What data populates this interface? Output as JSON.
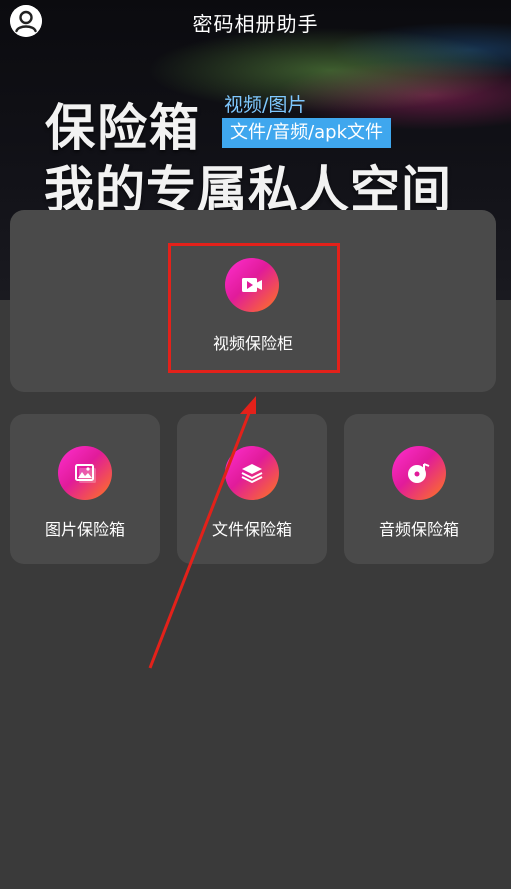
{
  "header": {
    "title": "密码相册助手"
  },
  "banner": {
    "headline": "保险箱",
    "sub_tag_1": "视频/图片",
    "sub_tag_2": "文件/音频/apk文件",
    "tagline": "我的专属私人空间"
  },
  "vaults": {
    "video": {
      "label": "视频保险柜",
      "icon": "video-icon"
    },
    "image": {
      "label": "图片保险箱",
      "icon": "image-icon"
    },
    "file": {
      "label": "文件保险箱",
      "icon": "layers-icon"
    },
    "audio": {
      "label": "音频保险箱",
      "icon": "music-disc-icon"
    }
  },
  "colors": {
    "background": "#3a3a3a",
    "card": "#4a4a4a",
    "icon_gradient_start": "#ff2fd0",
    "icon_gradient_end": "#ff7a1a",
    "annotation": "#e3211a",
    "tag_bg": "#3fa7ee"
  }
}
